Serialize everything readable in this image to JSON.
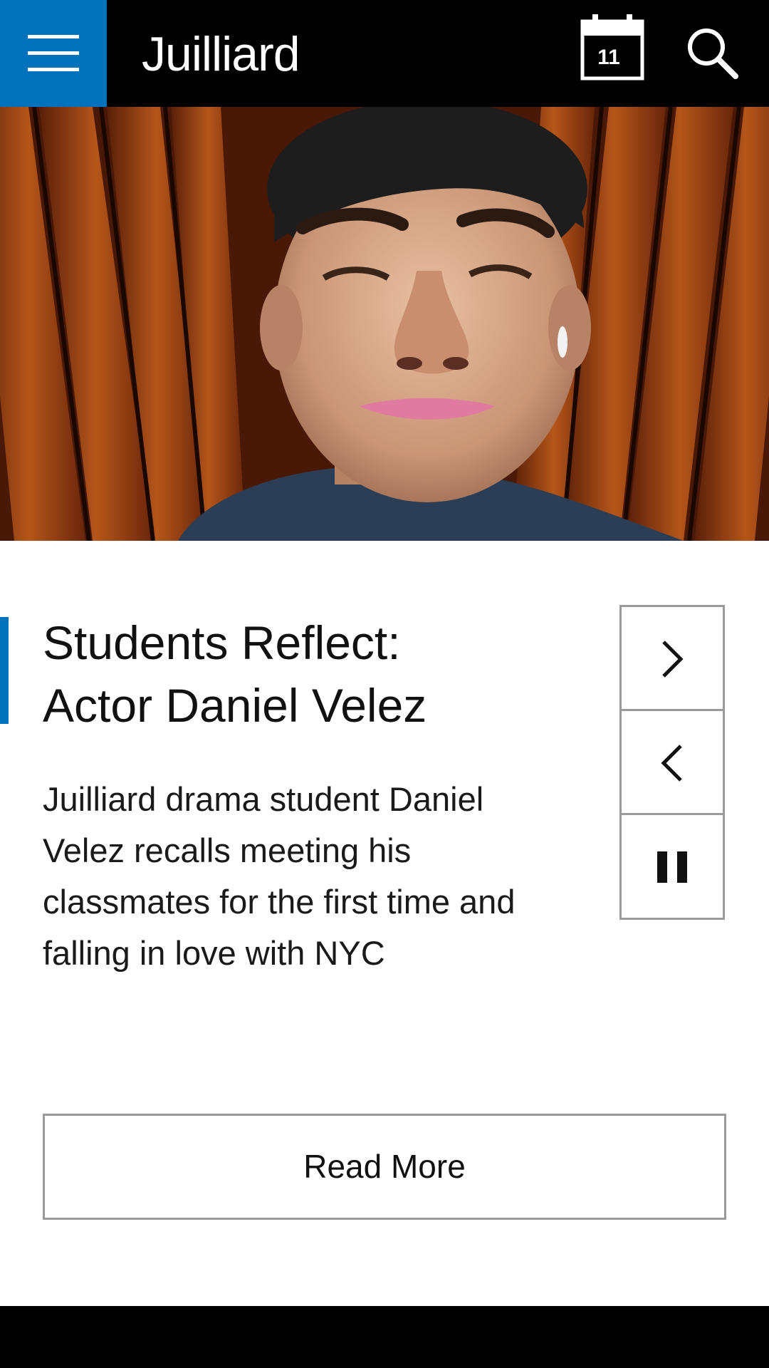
{
  "header": {
    "brand": "Juilliard",
    "calendar_day": "11",
    "menu_icon": "hamburger-menu-icon",
    "calendar_icon": "calendar-icon",
    "search_icon": "search-icon",
    "accent_color": "#0072bc"
  },
  "hero": {
    "image": "photo-portrait-student"
  },
  "article": {
    "title_line1": "Students Reflect:",
    "title_line2": "Actor Daniel Velez",
    "summary": "Juilliard drama student Daniel Velez recalls meeting his classmates for the first time and falling in love with NYC",
    "read_more_label": "Read More"
  },
  "controls": {
    "next_icon": "chevron-right-icon",
    "prev_icon": "chevron-left-icon",
    "pause_icon": "pause-icon"
  }
}
